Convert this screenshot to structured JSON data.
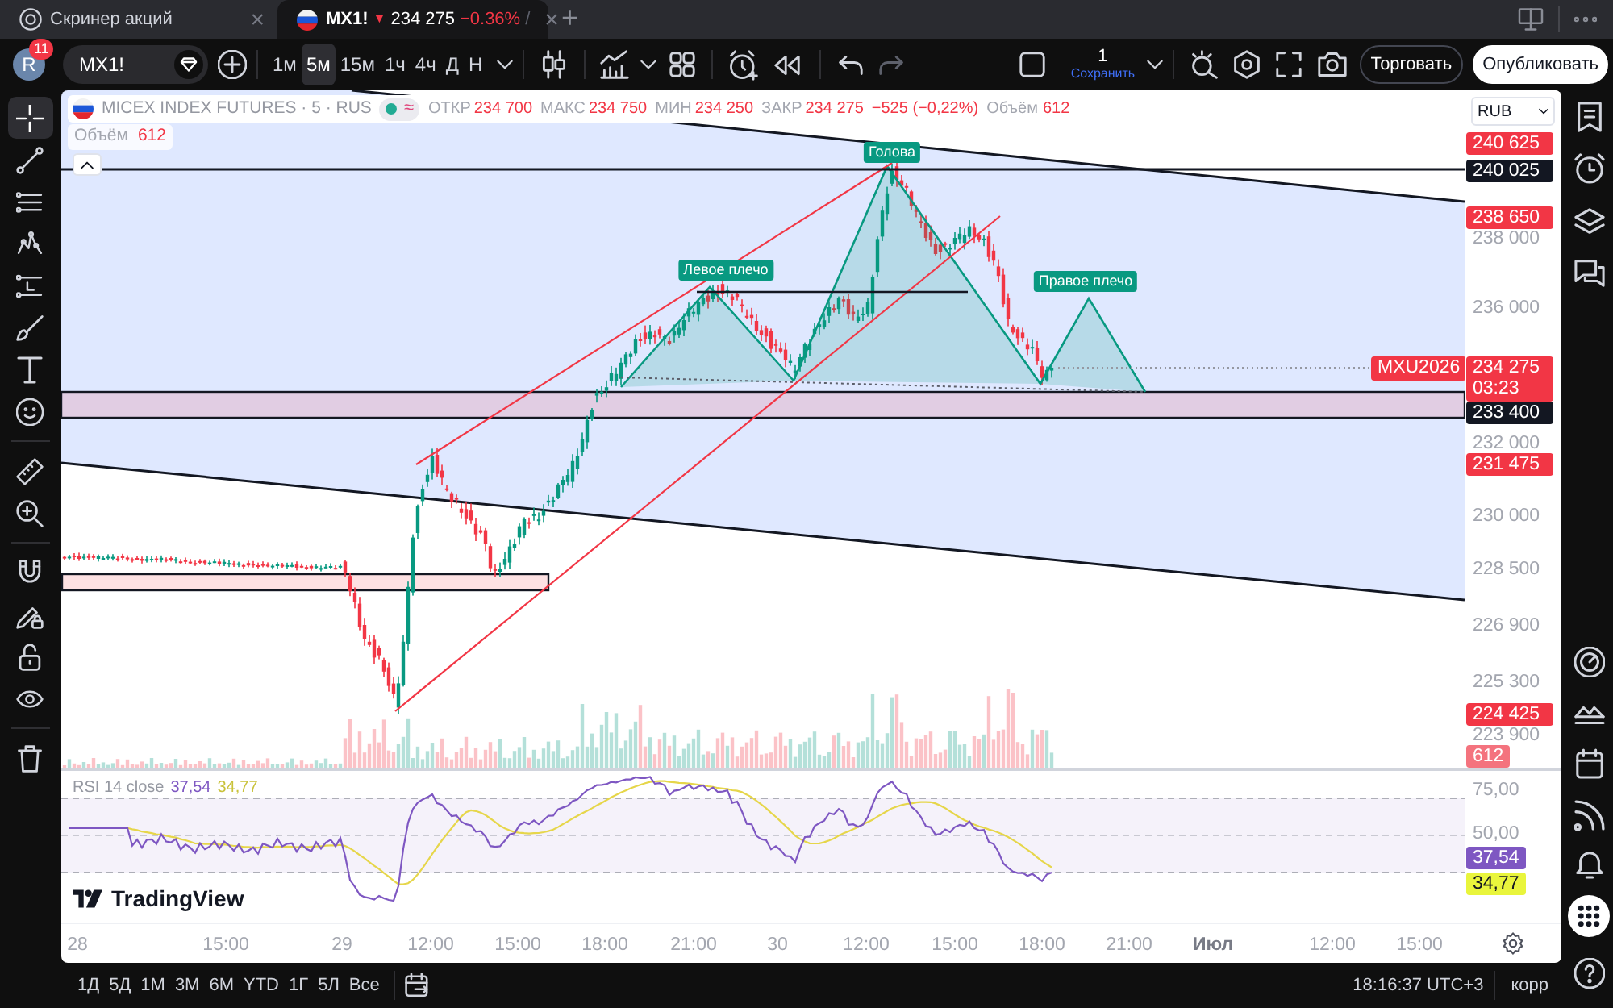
{
  "browser_tabs": [
    {
      "kind": "screener",
      "title": "Скринер акций",
      "close": "×",
      "selected": false
    },
    {
      "kind": "symbol",
      "title": "MX1!",
      "direction": "▼",
      "price": "234 275",
      "change": "−0.36%",
      "suffix": "/",
      "close": "×",
      "selected": true
    }
  ],
  "new_tab": "+",
  "toolbar": {
    "avatar": "R",
    "notifications": "11",
    "symbol": "MX1!",
    "intervals": [
      {
        "label": "1м",
        "selected": false
      },
      {
        "label": "5м",
        "selected": true
      },
      {
        "label": "15м",
        "selected": false
      },
      {
        "label": "1ч",
        "selected": false
      },
      {
        "label": "4ч",
        "selected": false
      },
      {
        "label": "Д",
        "selected": false
      },
      {
        "label": "Н",
        "selected": false
      }
    ],
    "layout_count": "1",
    "save": "Сохранить",
    "trade": "Торговать",
    "publish": "Опубликовать"
  },
  "tool_groups": [
    [
      {
        "kind": "crosshair",
        "selected": true
      },
      {
        "kind": "trendline",
        "selected": false
      },
      {
        "kind": "fibonacci",
        "selected": false
      },
      {
        "kind": "pattern",
        "selected": false
      },
      {
        "kind": "projection",
        "selected": false
      },
      {
        "kind": "brush",
        "selected": false
      },
      {
        "kind": "text",
        "selected": false
      },
      {
        "kind": "emoji",
        "selected": false
      }
    ],
    [
      {
        "kind": "ruler",
        "selected": false
      },
      {
        "kind": "zoom",
        "selected": false
      }
    ],
    [
      {
        "kind": "magnet",
        "selected": false
      },
      {
        "kind": "pencillock",
        "selected": false
      },
      {
        "kind": "lock",
        "selected": false
      },
      {
        "kind": "eye",
        "selected": false
      }
    ],
    [
      {
        "kind": "trash",
        "selected": false
      }
    ]
  ],
  "chart": {
    "legend": {
      "title": "MICEX INDEX FUTURES · 5 · RUS",
      "status": "≈",
      "ohlc": [
        {
          "label": "ОТКР",
          "value": "234 700"
        },
        {
          "label": "МАКС",
          "value": "234 750"
        },
        {
          "label": "МИН",
          "value": "234 250"
        },
        {
          "label": "ЗАКР",
          "value": "234 275"
        }
      ],
      "change": "−525 (−0,22%)",
      "volume_label": "Объём",
      "volume": "612"
    },
    "volume_legend": {
      "label": "Объём",
      "value": "612"
    },
    "currency": "RUB",
    "pattern_labels": [
      "Левое плечо",
      "Голова",
      "Правое плечо"
    ],
    "symbol_tag": "MXU2026",
    "price_scale": [
      {
        "kind": "alert",
        "text": "240 625"
      },
      {
        "kind": "line",
        "text": "240 025"
      },
      {
        "kind": "alert",
        "text": "238 650"
      },
      {
        "kind": "tick",
        "text": "238 000"
      },
      {
        "kind": "tick",
        "text": "236 000"
      },
      {
        "kind": "last",
        "text": "234 275",
        "countdown": "03:23"
      },
      {
        "kind": "line",
        "text": "233 400"
      },
      {
        "kind": "tick",
        "text": "232 000"
      },
      {
        "kind": "alert",
        "text": "231 475"
      },
      {
        "kind": "tick",
        "text": "230 000"
      },
      {
        "kind": "tick",
        "text": "228 500"
      },
      {
        "kind": "tick",
        "text": "226 900"
      },
      {
        "kind": "tick",
        "text": "225 300"
      },
      {
        "kind": "alert",
        "text": "224 425"
      },
      {
        "kind": "tick",
        "text": "223 900"
      },
      {
        "kind": "volume",
        "text": "612"
      }
    ]
  },
  "rsi": {
    "title": "RSI 14 close",
    "value": "37,54",
    "ma_value": "34,77",
    "scale": [
      {
        "kind": "tick",
        "text": "75,00"
      },
      {
        "kind": "tick",
        "text": "50,00"
      },
      {
        "kind": "rsi",
        "text": "37,54"
      },
      {
        "kind": "ma",
        "text": "34,77"
      }
    ]
  },
  "logo": "TradingView",
  "time_axis": [
    {
      "kind": "tick",
      "text": "28"
    },
    {
      "kind": "tick",
      "text": "15:00"
    },
    {
      "kind": "tick",
      "text": "29"
    },
    {
      "kind": "tick",
      "text": "12:00"
    },
    {
      "kind": "tick",
      "text": "15:00"
    },
    {
      "kind": "tick",
      "text": "18:00"
    },
    {
      "kind": "tick",
      "text": "21:00"
    },
    {
      "kind": "tick",
      "text": "30"
    },
    {
      "kind": "tick",
      "text": "12:00"
    },
    {
      "kind": "tick",
      "text": "15:00"
    },
    {
      "kind": "tick",
      "text": "18:00"
    },
    {
      "kind": "tick",
      "text": "21:00"
    },
    {
      "kind": "month",
      "text": "Июл"
    },
    {
      "kind": "tick",
      "text": "12:00"
    },
    {
      "kind": "tick",
      "text": "15:00"
    }
  ],
  "ranges": [
    "1Д",
    "5Д",
    "1М",
    "3М",
    "6М",
    "YTD",
    "1Г",
    "5Л",
    "Все"
  ],
  "clock": "18:16:37 UTC+3",
  "adjustment": "корр"
}
